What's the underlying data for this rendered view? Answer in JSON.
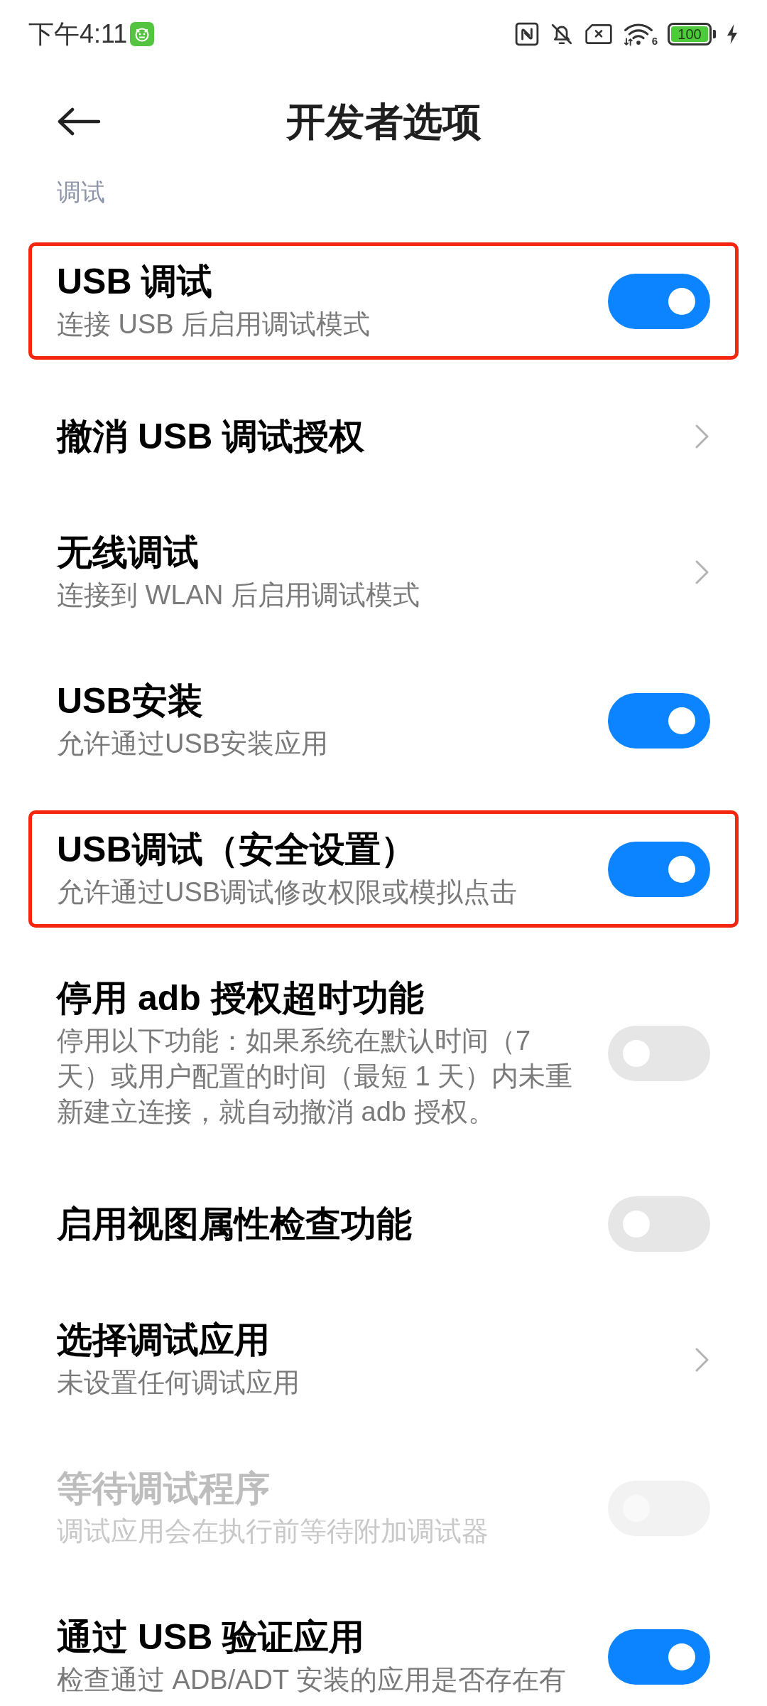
{
  "status_bar": {
    "time": "下午4:11",
    "wifi_badge": "6",
    "battery": "100"
  },
  "header": {
    "title": "开发者选项"
  },
  "section": {
    "label": "调试"
  },
  "rows": [
    {
      "kind": "toggle",
      "title": "USB 调试",
      "subtitle": "连接 USB 后启用调试模式",
      "on": true,
      "disabled": false,
      "highlighted": true
    },
    {
      "kind": "link",
      "title": "撤消 USB 调试授权",
      "disabled": false,
      "highlighted": false
    },
    {
      "kind": "link",
      "title": "无线调试",
      "subtitle": "连接到 WLAN 后启用调试模式",
      "disabled": false,
      "highlighted": false
    },
    {
      "kind": "toggle",
      "title": "USB安装",
      "subtitle": "允许通过USB安装应用",
      "on": true,
      "disabled": false,
      "highlighted": false
    },
    {
      "kind": "toggle",
      "title": "USB调试（安全设置）",
      "subtitle": "允许通过USB调试修改权限或模拟点击",
      "on": true,
      "disabled": false,
      "highlighted": true
    },
    {
      "kind": "toggle",
      "title": "停用 adb 授权超时功能",
      "subtitle": "停用以下功能：如果系统在默认时间（7 天）或用户配置的时间（最短 1 天）内未重新建立连接，就自动撤消 adb 授权。",
      "on": false,
      "disabled": false,
      "highlighted": false
    },
    {
      "kind": "toggle",
      "title": "启用视图属性检查功能",
      "on": false,
      "disabled": false,
      "highlighted": false
    },
    {
      "kind": "link",
      "title": "选择调试应用",
      "subtitle": "未设置任何调试应用",
      "disabled": false,
      "highlighted": false
    },
    {
      "kind": "toggle",
      "title": "等待调试程序",
      "subtitle": "调试应用会在执行前等待附加调试器",
      "on": false,
      "disabled": true,
      "highlighted": false
    },
    {
      "kind": "toggle",
      "title": "通过 USB 验证应用",
      "subtitle": "检查通过 ADB/ADT 安装的应用是否存在有",
      "on": true,
      "disabled": false,
      "highlighted": false
    }
  ]
}
